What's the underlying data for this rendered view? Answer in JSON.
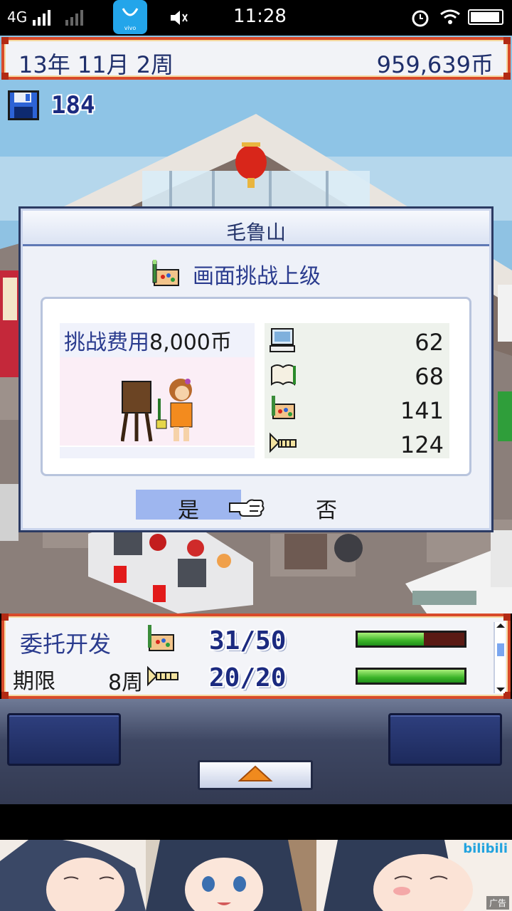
{
  "status_bar": {
    "network": "4G",
    "time": "11:28"
  },
  "header": {
    "date": "13年 11月 2周",
    "money": "959,639币"
  },
  "save": {
    "count": "184"
  },
  "dialog": {
    "title": "毛鲁山",
    "subtitle": "画面挑战上级",
    "cost_label": "挑战费用",
    "cost_value": "8,000币",
    "stats": [
      {
        "icon": "computer-icon",
        "value": "62"
      },
      {
        "icon": "book-icon",
        "value": "68"
      },
      {
        "icon": "graphics-icon",
        "value": "141"
      },
      {
        "icon": "sound-icon",
        "value": "124"
      }
    ],
    "yes_label": "是",
    "no_label": "否"
  },
  "project": {
    "title": "委托开发",
    "deadline_label": "期限",
    "deadline_value": "8周",
    "graphics_progress": "31/50",
    "graphics_fraction": 0.62,
    "sound_progress": "20/20",
    "sound_fraction": 1.0
  },
  "ad": {
    "badge": "广告",
    "brand": "bilibili"
  },
  "colors": {
    "frame_red": "#d84a2a",
    "navy_text": "#1b2a80",
    "selection_blue": "#9eb6ef",
    "bar_green": "#3db52a"
  }
}
